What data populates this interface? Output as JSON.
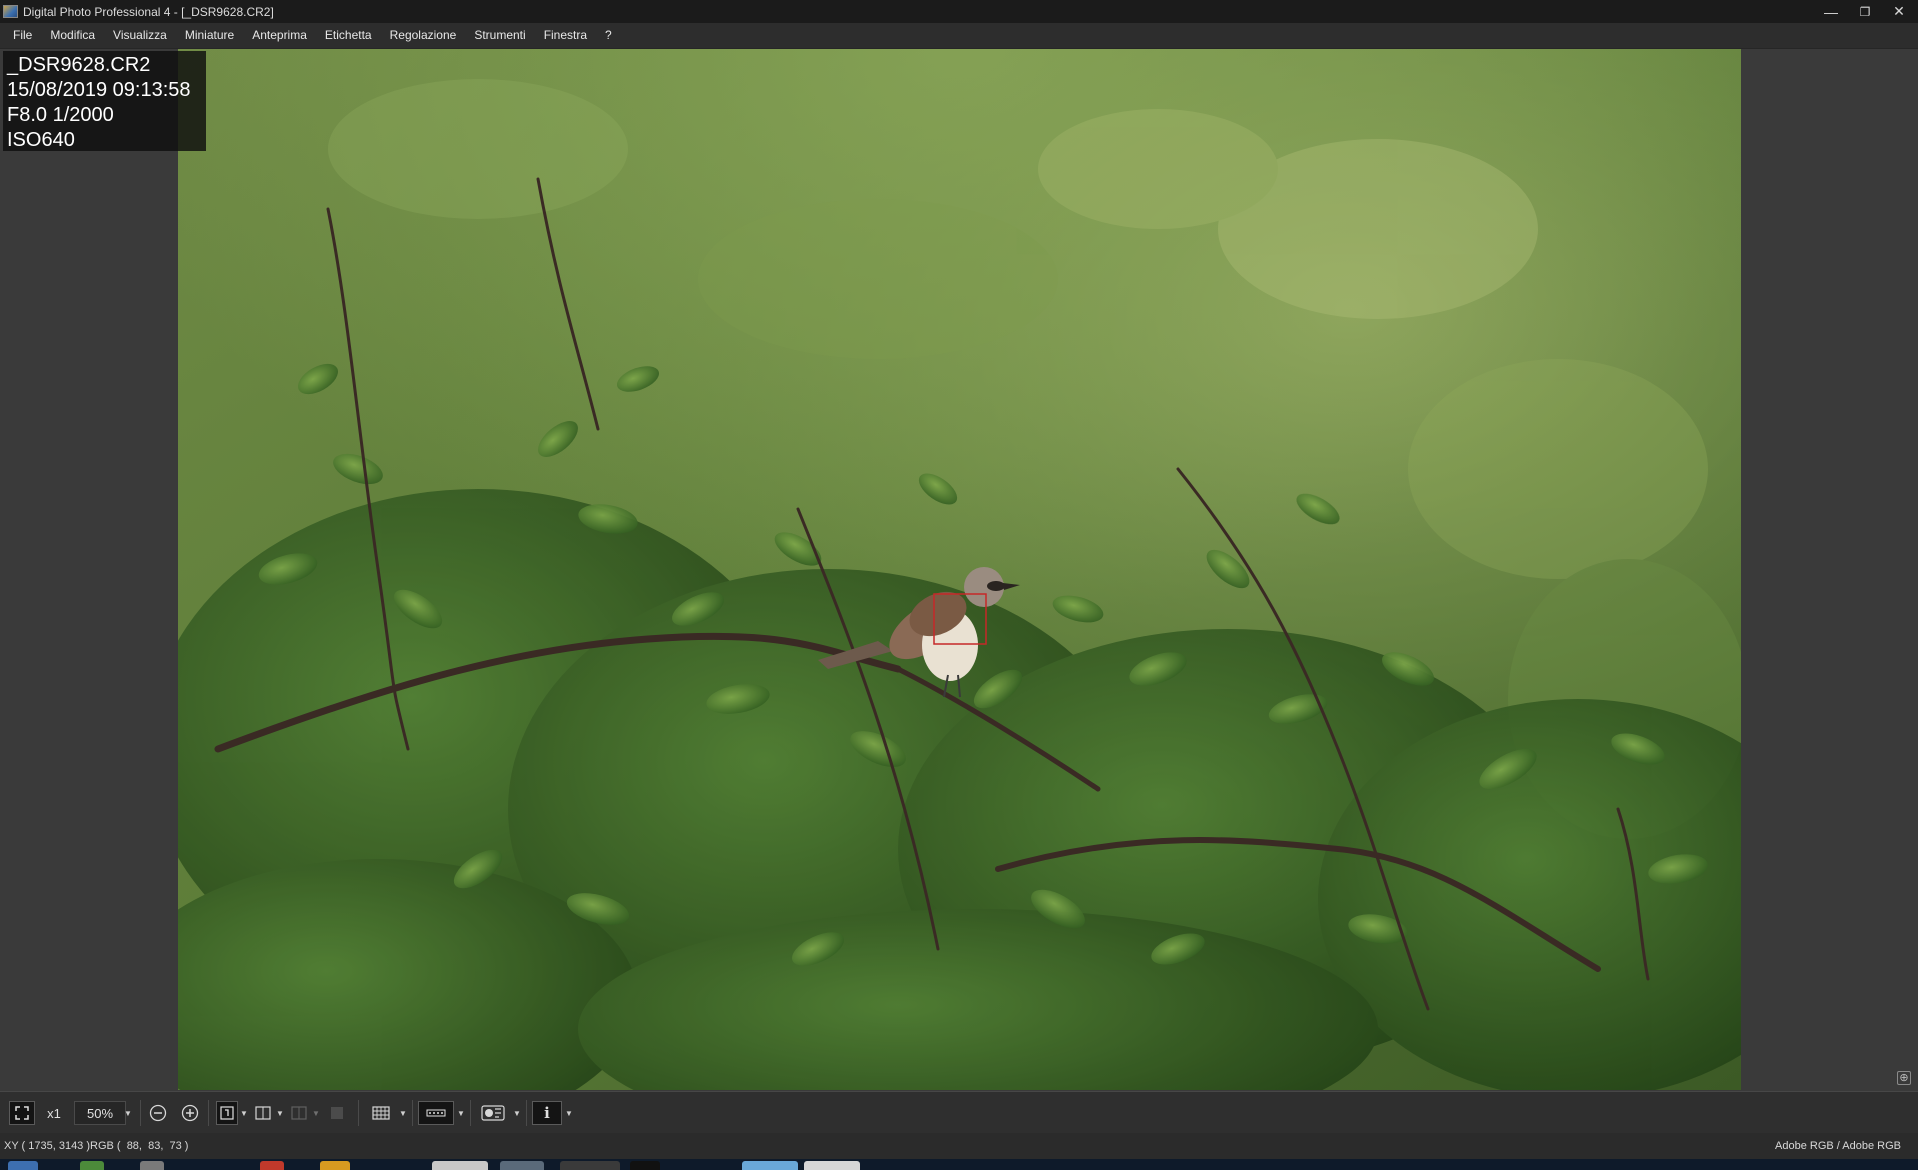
{
  "window": {
    "title": "Digital Photo Professional 4 - [_DSR9628.CR2]",
    "minimize_glyph": "—",
    "restore_glyph": "❐",
    "close_glyph": "✕"
  },
  "menu": {
    "items": [
      {
        "label": "File"
      },
      {
        "label": "Modifica"
      },
      {
        "label": "Visualizza"
      },
      {
        "label": "Miniature"
      },
      {
        "label": "Anteprima"
      },
      {
        "label": "Etichetta"
      },
      {
        "label": "Regolazione"
      },
      {
        "label": "Strumenti"
      },
      {
        "label": "Finestra"
      },
      {
        "label": "?"
      }
    ]
  },
  "image_info": {
    "filename": "_DSR9628.CR2",
    "datetime": "15/08/2019 09:13:58",
    "exposure": "F8.0 1/2000",
    "iso": "ISO640"
  },
  "toolbar": {
    "fit_icon": "fit-to-window-icon",
    "zoom_100_label": "x1",
    "zoom_level": "50%",
    "zoom_out_icon": "zoom-out-icon",
    "zoom_in_icon": "zoom-in-icon",
    "af_point_icon": "af-point-icon",
    "compare_icon": "compare-layout-icon",
    "grid_icon": "grid-overlay-icon",
    "highlight_icon": "highlight-warning-icon",
    "info_glyph": "i"
  },
  "status": {
    "readout": "XY ( 1735, 3143 )RGB (  88,  83,  73 )",
    "color_profile": "Adobe RGB / Adobe RGB"
  },
  "colors": {
    "accent_focus_box": "#c62828",
    "titlebar": "#1b1b1b",
    "background": "#3a3a3a"
  }
}
